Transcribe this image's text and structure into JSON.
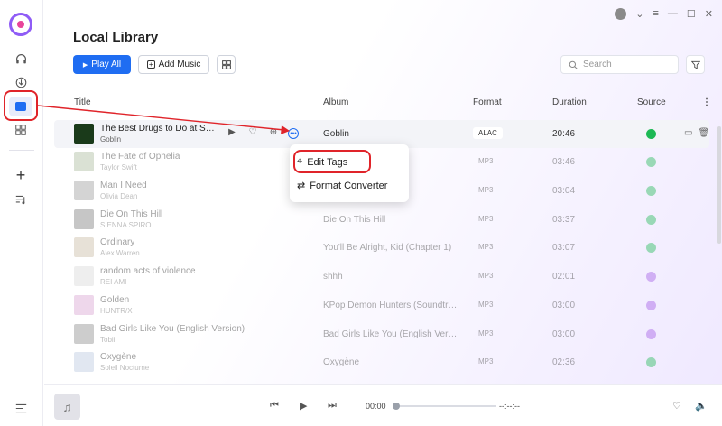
{
  "page": {
    "title": "Local Library"
  },
  "toolbar": {
    "play_all_label": "Play All",
    "add_music_label": "Add Music"
  },
  "search": {
    "placeholder": "Search"
  },
  "columns": {
    "title": "Title",
    "album": "Album",
    "format": "Format",
    "duration": "Duration",
    "source": "Source"
  },
  "rows": [
    {
      "title": "The Best Drugs to Do at Sc...",
      "artist": "Goblin",
      "album": "Goblin",
      "format": "ALAC",
      "duration": "20:46",
      "source": "spotify"
    },
    {
      "title": "The Fate of Ophelia",
      "artist": "Taylor Swift",
      "album": "",
      "format": "MP3",
      "duration": "03:46",
      "source": "spotify"
    },
    {
      "title": "Man I Need",
      "artist": "Olivia Dean",
      "album": "",
      "format": "MP3",
      "duration": "03:04",
      "source": "spotify"
    },
    {
      "title": "Die On This Hill",
      "artist": "SIENNA SPIRO",
      "album": "Die On This Hill",
      "format": "MP3",
      "duration": "03:37",
      "source": "spotify"
    },
    {
      "title": "Ordinary",
      "artist": "Alex Warren",
      "album": "You'll Be Alright, Kid (Chapter 1)",
      "format": "MP3",
      "duration": "03:07",
      "source": "spotify"
    },
    {
      "title": "random acts of violence",
      "artist": "REI AMI",
      "album": "shhh",
      "format": "MP3",
      "duration": "02:01",
      "source": "apple"
    },
    {
      "title": "Golden",
      "artist": "HUNTR/X",
      "album": "KPop Demon Hunters (Soundtrac...",
      "format": "MP3",
      "duration": "03:00",
      "source": "apple"
    },
    {
      "title": "Bad Girls Like You (English Version)",
      "artist": "Tobii",
      "album": "Bad Girls Like You (English Versio...",
      "format": "MP3",
      "duration": "03:00",
      "source": "apple"
    },
    {
      "title": "Oxygène",
      "artist": "Soleil Nocturne",
      "album": "Oxygène",
      "format": "MP3",
      "duration": "02:36",
      "source": "spotify"
    }
  ],
  "context_menu": {
    "edit_tags": "Edit Tags",
    "format_converter": "Format Converter"
  },
  "player": {
    "current_time": "00:00",
    "total_time": "--:--:--",
    "progress": 0
  },
  "colors": {
    "accent": "#1f6df2",
    "highlight": "#e0242a",
    "spotify": "#1db954",
    "apple": "#a259e6"
  },
  "icons": {
    "sidebar": [
      "app-logo-icon",
      "headphones-icon",
      "download-icon",
      "library-icon",
      "grid-icon",
      "plus-icon",
      "playlist-icon",
      "menu-icon"
    ],
    "window": [
      "user-icon",
      "chevron-down-icon",
      "menu-icon",
      "minimize-icon",
      "maximize-icon",
      "close-icon"
    ]
  }
}
